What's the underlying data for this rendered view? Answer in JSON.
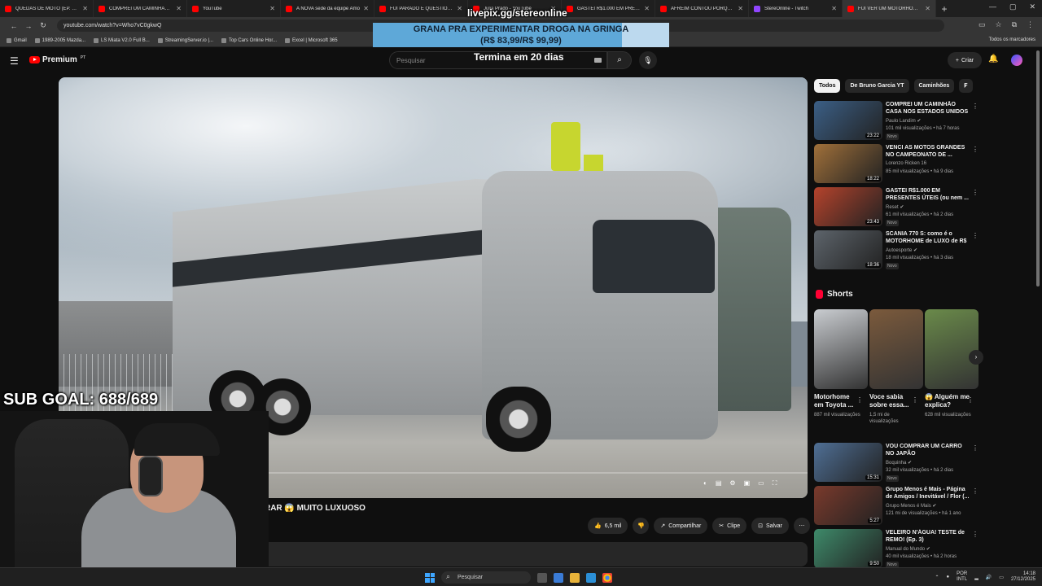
{
  "browser": {
    "tabs": [
      {
        "label": "QUEDAS DE MOTO (EP. 163)",
        "kind": "yt"
      },
      {
        "label": "COMPREI UM CAMINHÃO CA",
        "kind": "yt"
      },
      {
        "label": "YouTube",
        "kind": "yt"
      },
      {
        "label": "A NOVA sede da equipe Amo",
        "kind": "yt"
      },
      {
        "label": "FUI PARADO E QUESTIONADO",
        "kind": "yt"
      },
      {
        "label": "Julia Prado - YouTube",
        "kind": "yt"
      },
      {
        "label": "GASTEI R$1.000 EM PRESENTE",
        "kind": "yt"
      },
      {
        "label": "AFREIM CONTOU PORQUE FU",
        "kind": "yt"
      },
      {
        "label": "StereOnline - Twitch",
        "kind": "tw"
      },
      {
        "label": "FUI VER UM MOTORHOME D",
        "kind": "yt"
      }
    ],
    "url": "youtube.com/watch?v=Who7vC0gkwQ",
    "bookmarks": [
      "Gmail",
      "1989-2005 Mazda...",
      "LS Miata V2.0 Full B...",
      "StreamingServer.io |...",
      "Top Cars Online Hor...",
      "Excel | Microsoft 365"
    ],
    "bookmarks_right": "Todos os marcadores"
  },
  "youtube": {
    "logo": "Premium",
    "logo_sup": "PT",
    "search_placeholder": "Pesquisar",
    "create_label": "Criar",
    "video_title_partial": "000 PRA COMPRAR 😱 MUITO LUXUOSO",
    "actions": {
      "likes": "6,5 mil",
      "share": "Compartilhar",
      "clip": "Clipe",
      "save": "Salvar"
    }
  },
  "overlay": {
    "pix_url": "livepix.gg/stereonline",
    "goal_title": "GRANA PRA EXPERIMENTAR DROGA NA GRINGA",
    "goal_amount": "(R$ 83,99/R$ 99,99)",
    "goal_progress": 0.84,
    "goal_end": "Termina em 20 dias",
    "sub_goal": "SUB GOAL: 688/689"
  },
  "sidebar": {
    "chips": [
      "Todos",
      "De Bruno Garcia YT",
      "Caminhões",
      "F"
    ],
    "recs_top": [
      {
        "title": "COMPREI UM CAMINHÃO CASA NOS ESTADOS UNIDOS ...",
        "channel": "Paulo Landim ✔",
        "meta": "101 mil visualizações • há 7 horas",
        "badge": "Novo",
        "duration": "23:22",
        "thumb": "#3b5f86"
      },
      {
        "title": "VENCI AS MOTOS GRANDES NO CAMPEONATO DE ...",
        "channel": "Lorenzo Ricken 16",
        "meta": "85 mil visualizações • há 9 dias",
        "badge": "",
        "duration": "18:22",
        "thumb": "#a0703a"
      },
      {
        "title": "GASTEI R$1.000 EM PRESENTES ÚTEIS (ou nem ...",
        "channel": "Reset ✔",
        "meta": "61 mil visualizações • há 2 dias",
        "badge": "Novo",
        "duration": "23:43",
        "thumb": "#b5432c"
      },
      {
        "title": "SCANIA 770 S: como é o MOTORHOME de LUXO de R$ ...",
        "channel": "Autoesporte ✔",
        "meta": "18 mil visualizações • há 3 dias",
        "badge": "Novo",
        "duration": "18:36",
        "thumb": "#5d646b"
      }
    ],
    "shorts_heading": "Shorts",
    "shorts": [
      {
        "title": "Motorhome em Toyota ...",
        "views": "887 mil visualizações",
        "thumb": "#c9ccd0"
      },
      {
        "title": "Voce sabia sobre essa...",
        "views": "1,5 mi de visualizações",
        "thumb": "#7b5a3c"
      },
      {
        "title": "😱 Alguém me explica?",
        "views": "628 mil visualizações",
        "thumb": "#6a8a4a"
      }
    ],
    "recs_bottom": [
      {
        "title": "VOU COMPRAR UM CARRO NO JAPÃO",
        "channel": "Boquinha ✔",
        "meta": "32 mil visualizações • há 2 dias",
        "badge": "Novo",
        "duration": "15:31",
        "thumb": "#4f6f95"
      },
      {
        "title": "Grupo Menos é Mais - Página de Amigos / Inevitável / Flor (...",
        "channel": "Grupo Menos é Mais ✔",
        "meta": "121 mi de visualizações • há 1 ano",
        "badge": "",
        "duration": "5:27",
        "thumb": "#7a3a2c"
      },
      {
        "title": "VELEIRO N'ÁGUA! TESTE de REMO! (Ep. 3)",
        "channel": "Manual do Mundo ✔",
        "meta": "40 mil visualizações • há 2 horas",
        "badge": "Novo",
        "duration": "9:50",
        "thumb": "#3e8a6a"
      }
    ]
  },
  "taskbar": {
    "search": "Pesquisar",
    "lang": "POR",
    "lang2": "INTL",
    "time": "14:18",
    "date": "27/12/2025"
  },
  "colors": {
    "yt_red": "#ff0000",
    "goal_bg": "#5ea8d8",
    "bg": "#0f0f0f"
  }
}
